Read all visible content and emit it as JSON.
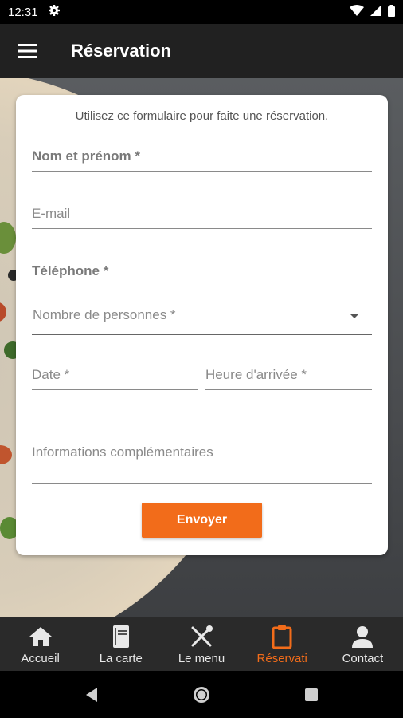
{
  "status": {
    "time": "12:31"
  },
  "app_bar": {
    "title": "Réservation"
  },
  "form": {
    "intro": "Utilisez ce formulaire pour faite une réservation.",
    "name_label": "Nom et prénom *",
    "email_label": "E-mail",
    "phone_label": "Téléphone *",
    "persons_label": "Nombre de personnes *",
    "date_label": "Date *",
    "time_label": "Heure d'arrivée *",
    "info_label": "Informations complémentaires",
    "submit_label": "Envoyer"
  },
  "nav": {
    "items": [
      {
        "label": "Accueil",
        "icon": "home-icon"
      },
      {
        "label": "La carte",
        "icon": "book-icon"
      },
      {
        "label": "Le menu",
        "icon": "utensils-icon"
      },
      {
        "label": "Réservati",
        "icon": "clipboard-icon"
      },
      {
        "label": "Contact",
        "icon": "person-icon"
      }
    ],
    "active_index": 3
  },
  "colors": {
    "accent": "#f26c1a",
    "app_bar": "#212121",
    "nav_bg": "#2a2a2a"
  }
}
